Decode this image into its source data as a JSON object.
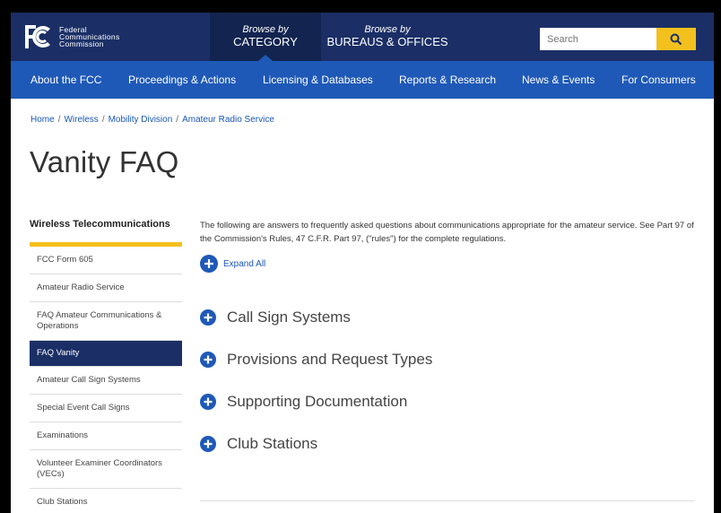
{
  "header": {
    "logo_letters": "FCC",
    "agency_name": [
      "Federal",
      "Communications",
      "Commission"
    ],
    "browse_category_small": "Browse by",
    "browse_category_big": "CATEGORY",
    "browse_bureaus_small": "Browse by",
    "browse_bureaus_big": "BUREAUS & OFFICES",
    "search_placeholder": "Search"
  },
  "nav": {
    "items": [
      "About the FCC",
      "Proceedings & Actions",
      "Licensing & Databases",
      "Reports & Research",
      "News & Events",
      "For Consumers"
    ]
  },
  "breadcrumb": [
    "Home",
    "Wireless",
    "Mobility Division",
    "Amateur Radio Service"
  ],
  "page_title": "Vanity FAQ",
  "sidebar": {
    "heading": "Wireless Telecommunications",
    "items": [
      {
        "label": "FCC Form 605",
        "active": false
      },
      {
        "label": "Amateur Radio Service",
        "active": false
      },
      {
        "label": "FAQ Amateur Communications & Operations",
        "active": false
      },
      {
        "label": "FAQ Vanity",
        "active": true
      },
      {
        "label": "Amateur Call Sign Systems",
        "active": false
      },
      {
        "label": "Special Event Call Signs",
        "active": false
      },
      {
        "label": "Examinations",
        "active": false
      },
      {
        "label": "Volunteer Examiner Coordinators (VECs)",
        "active": false
      },
      {
        "label": "Club Stations",
        "active": false
      }
    ]
  },
  "main": {
    "intro": "The following are answers to frequently asked questions about communications appropriate for the amateur service. See Part 97 of the Commission's Rules, 47 C.F.R. Part 97, (\"rules\") for the complete regulations.",
    "expand_all": "Expand All",
    "sections": [
      "Call Sign Systems",
      "Provisions and Request Types",
      "Supporting Documentation",
      "Club Stations"
    ]
  },
  "colors": {
    "header_dark": "#1b2f66",
    "nav_blue": "#1f59b7",
    "accent_yellow": "#f3c11d",
    "link_blue": "#1a56b5"
  }
}
